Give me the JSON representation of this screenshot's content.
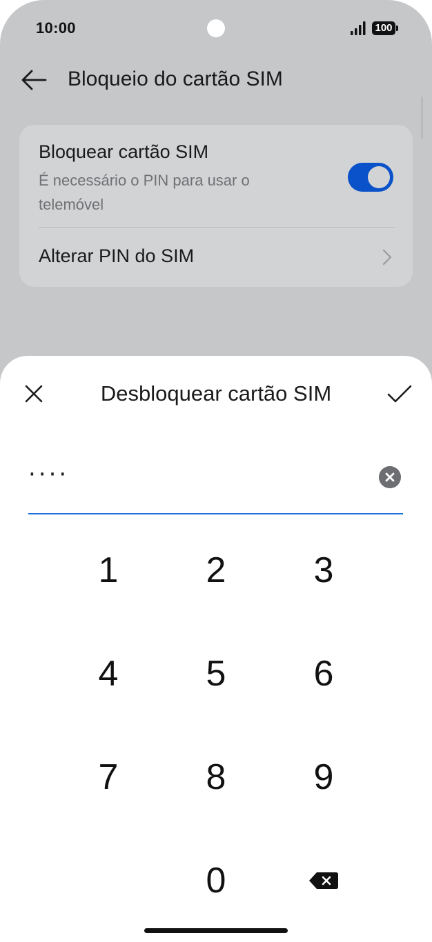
{
  "status_bar": {
    "time": "10:00",
    "battery": "100",
    "icons": [
      "camera-hole",
      "signal-icon",
      "battery-icon"
    ]
  },
  "header": {
    "title": "Bloqueio do cartão SIM",
    "back_icon": "arrow-left-icon"
  },
  "settings": {
    "lock_sim": {
      "title": "Bloquear cartão SIM",
      "subtitle": "É necessário o PIN para usar o telemóvel",
      "enabled": true
    },
    "change_pin": {
      "label": "Alterar PIN do SIM",
      "icon": "chevron-right-icon"
    }
  },
  "dialog": {
    "title": "Desbloquear cartão SIM",
    "close_icon": "close-icon",
    "confirm_icon": "check-icon",
    "pin_value": "····",
    "clear_icon": "clear-circle-icon"
  },
  "keypad": {
    "keys": [
      "1",
      "2",
      "3",
      "4",
      "5",
      "6",
      "7",
      "8",
      "9",
      "0"
    ],
    "backspace_icon": "backspace-icon"
  },
  "colors": {
    "backdrop": "#c6c7c9",
    "card": "#d2d3d5",
    "accent": "#0a52c9",
    "field_underline": "#1c6fd9"
  }
}
